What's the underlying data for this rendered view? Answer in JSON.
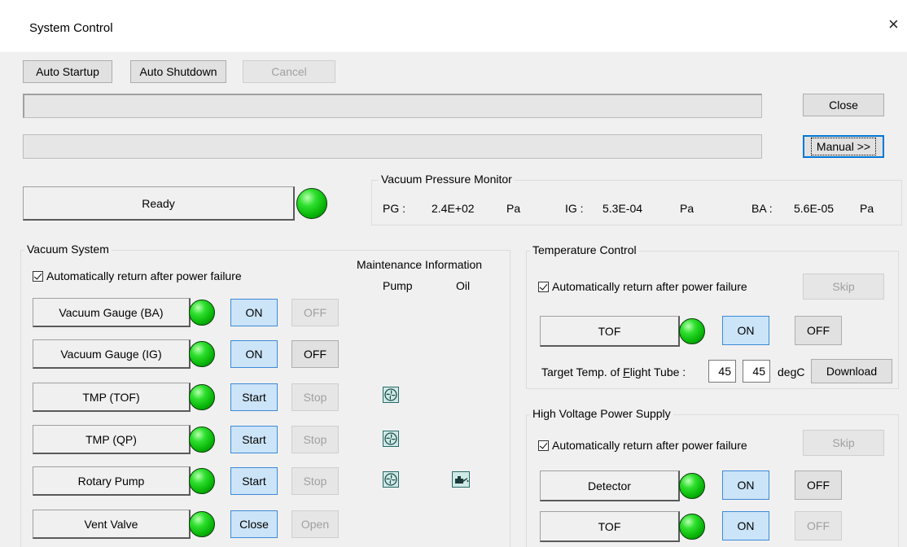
{
  "window": {
    "title": "System Control",
    "close_symbol": "×"
  },
  "toolbar": {
    "auto_startup": "Auto Startup",
    "auto_shutdown": "Auto Shutdown",
    "cancel": "Cancel",
    "close": "Close",
    "manual": "Manual >>"
  },
  "status": {
    "text": "Ready"
  },
  "vacuum_monitor": {
    "title": "Vacuum Pressure Monitor",
    "pg_label": "PG :",
    "pg_value": "2.4E+02",
    "pg_unit": "Pa",
    "ig_label": "IG :",
    "ig_value": "5.3E-04",
    "ig_unit": "Pa",
    "ba_label": "BA :",
    "ba_value": "5.6E-05",
    "ba_unit": "Pa"
  },
  "vacuum_system": {
    "title": "Vacuum System",
    "auto_return": "Automatically return after power failure",
    "maintenance_title": "Maintenance Information",
    "pump_col": "Pump",
    "oil_col": "Oil",
    "rows": [
      {
        "label": "Vacuum Gauge (BA)",
        "btn1": "ON",
        "btn2": "OFF"
      },
      {
        "label": "Vacuum Gauge (IG)",
        "btn1": "ON",
        "btn2": "OFF"
      },
      {
        "label": "TMP (TOF)",
        "btn1": "Start",
        "btn2": "Stop"
      },
      {
        "label": "TMP (QP)",
        "btn1": "Start",
        "btn2": "Stop"
      },
      {
        "label": "Rotary Pump",
        "btn1": "Start",
        "btn2": "Stop"
      },
      {
        "label": "Vent Valve",
        "btn1": "Close",
        "btn2": "Open"
      }
    ]
  },
  "temperature_control": {
    "title": "Temperature Control",
    "auto_return": "Automatically return after power failure",
    "skip": "Skip",
    "device": "TOF",
    "on": "ON",
    "off": "OFF",
    "target_label_pre": "Target Temp. of ",
    "target_label_u": "F",
    "target_label_post": "light Tube :",
    "value1": "45",
    "value2": "45",
    "unit": "degC",
    "download": "Download"
  },
  "high_voltage": {
    "title": "High Voltage Power Supply",
    "auto_return": "Automatically return after power failure",
    "skip": "Skip",
    "rows": [
      {
        "label": "Detector",
        "on": "ON",
        "off": "OFF"
      },
      {
        "label": "TOF",
        "on": "ON",
        "off": "OFF"
      }
    ]
  },
  "colors": {
    "led_green": "#08b508",
    "accent_blue": "#0078d7"
  },
  "icons": {
    "pump": "fan-icon",
    "oil": "oil-can-icon"
  }
}
